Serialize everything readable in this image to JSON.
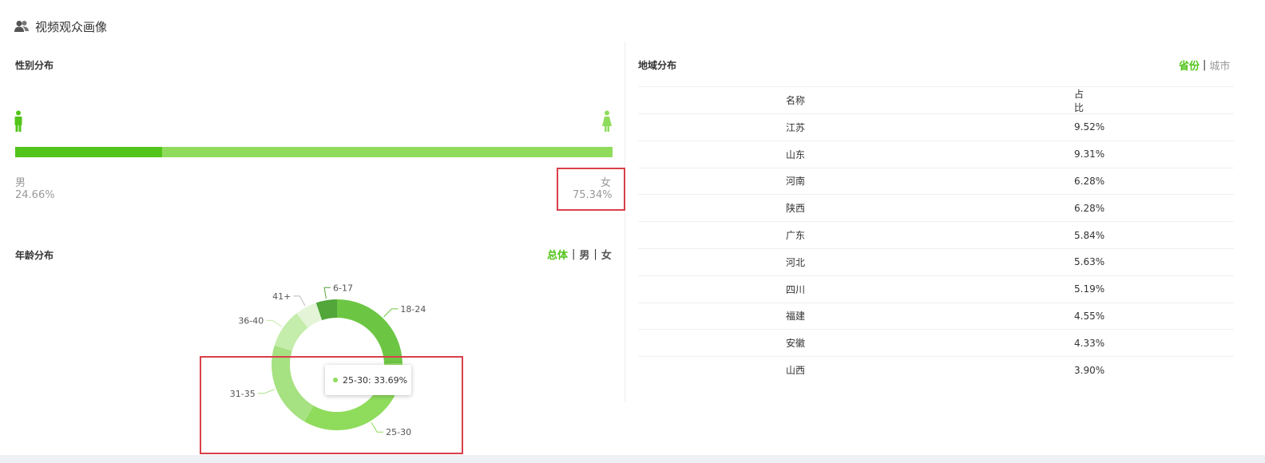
{
  "header": {
    "title": "视频观众画像"
  },
  "gender": {
    "title": "性别分布",
    "male": {
      "label": "男",
      "value": "24.66%",
      "share": 24.66
    },
    "female": {
      "label": "女",
      "value": "75.34%",
      "share": 75.34
    }
  },
  "age": {
    "title": "年龄分布",
    "tabs": [
      {
        "label": "总体",
        "active": true
      },
      {
        "label": "男",
        "active": false
      },
      {
        "label": "女",
        "active": false
      }
    ],
    "tooltip": "25-30: 33.69%"
  },
  "chart_data": {
    "type": "pie",
    "variant": "donut",
    "categories": [
      "6-17",
      "18-24",
      "25-30",
      "31-35",
      "36-40",
      "41+"
    ],
    "values": [
      5.2,
      24.6,
      33.69,
      21.5,
      9.6,
      5.4
    ],
    "colors": [
      "#52a63a",
      "#6cc644",
      "#8fdc5c",
      "#a6e182",
      "#c4ecab",
      "#e3f5d6"
    ]
  },
  "region": {
    "title": "地域分布",
    "tabs": [
      {
        "label": "省份",
        "active": true
      },
      {
        "label": "城市",
        "active": false
      }
    ],
    "columns": [
      "名称",
      "占比"
    ],
    "rows": [
      [
        "江苏",
        "9.52%"
      ],
      [
        "山东",
        "9.31%"
      ],
      [
        "河南",
        "6.28%"
      ],
      [
        "陕西",
        "6.28%"
      ],
      [
        "广东",
        "5.84%"
      ],
      [
        "河北",
        "5.63%"
      ],
      [
        "四川",
        "5.19%"
      ],
      [
        "福建",
        "4.55%"
      ],
      [
        "安徽",
        "4.33%"
      ],
      [
        "山西",
        "3.90%"
      ]
    ]
  },
  "colors": {
    "accent": "#52c41a",
    "bar_light": "#8fdc5c",
    "highlight": "#d9404a"
  }
}
